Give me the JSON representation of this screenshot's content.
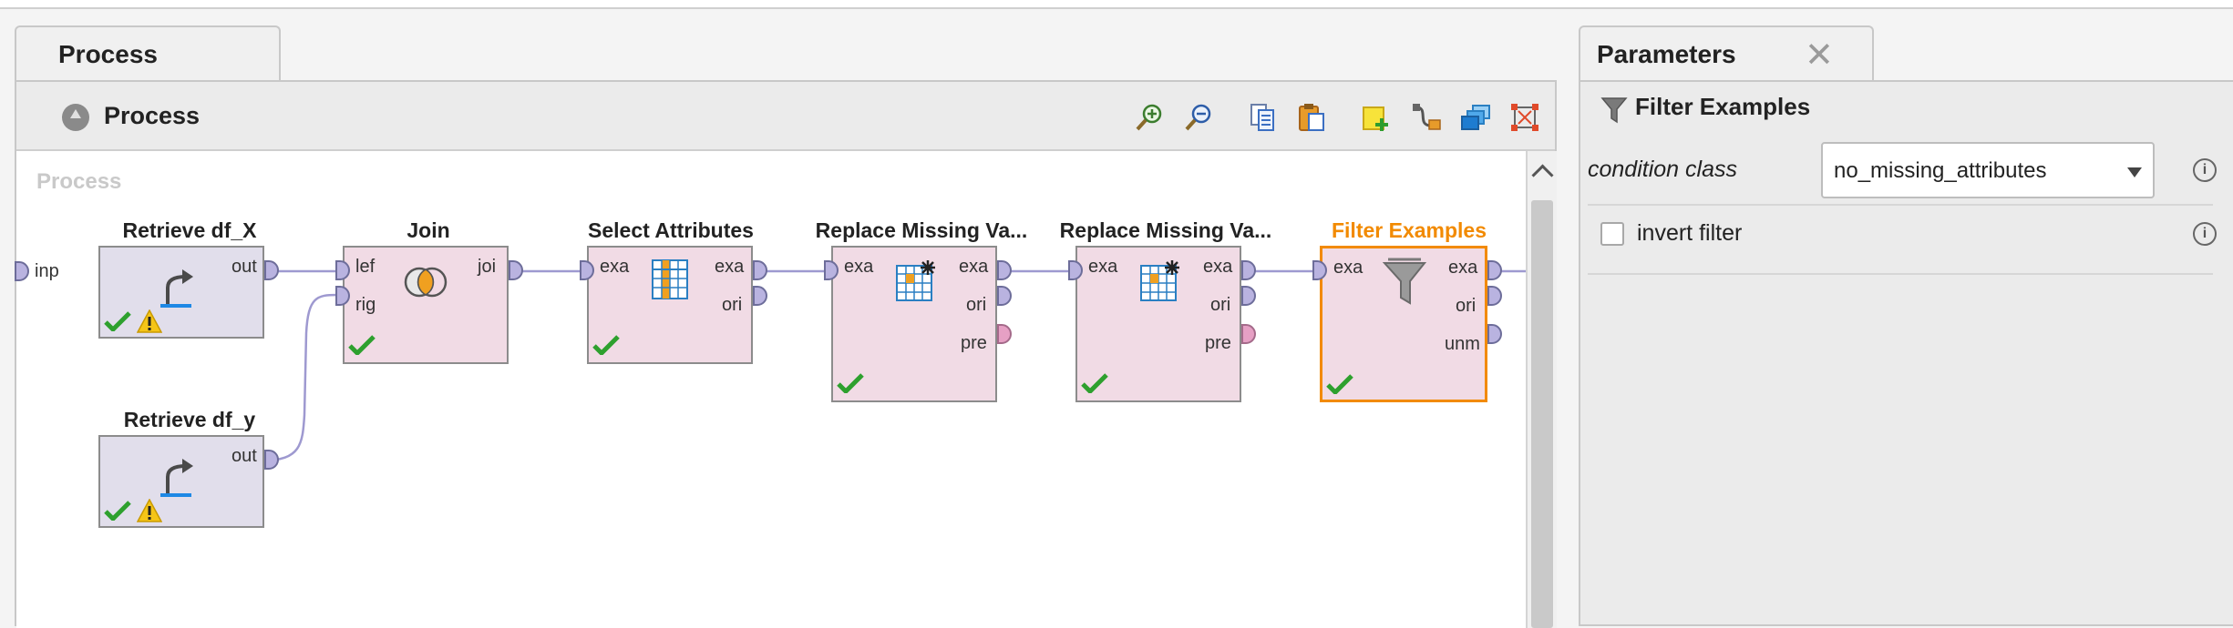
{
  "process_tab": {
    "label": "Process"
  },
  "breadcrumb": {
    "label": "Process"
  },
  "canvas": {
    "title": "Process",
    "input_port": "inp"
  },
  "toolbar": {
    "icons": [
      "zoom-in-icon",
      "zoom-out-icon",
      "copy-icon",
      "paste-icon",
      "add-note-icon",
      "auto-wire-icon",
      "arrange-icon",
      "fit-icon"
    ]
  },
  "operators": {
    "retrieve_x": {
      "title": "Retrieve df_X",
      "ports_out": [
        "out"
      ]
    },
    "retrieve_y": {
      "title": "Retrieve df_y",
      "ports_out": [
        "out"
      ]
    },
    "join": {
      "title": "Join",
      "ports_in": [
        "lef",
        "rig"
      ],
      "ports_out": [
        "joi"
      ]
    },
    "select_attributes": {
      "title": "Select Attributes",
      "ports_in": [
        "exa"
      ],
      "ports_out": [
        "exa",
        "ori"
      ]
    },
    "replace_missing_1": {
      "title": "Replace Missing Va...",
      "ports_in": [
        "exa"
      ],
      "ports_out": [
        "exa",
        "ori",
        "pre"
      ]
    },
    "replace_missing_2": {
      "title": "Replace Missing Va...",
      "ports_in": [
        "exa"
      ],
      "ports_out": [
        "exa",
        "ori",
        "pre"
      ]
    },
    "filter_examples": {
      "title": "Filter Examples",
      "ports_in": [
        "exa"
      ],
      "ports_out": [
        "exa",
        "ori",
        "unm"
      ]
    }
  },
  "parameters_tab": {
    "label": "Parameters",
    "close": "✕"
  },
  "parameters": {
    "operator_name": "Filter Examples",
    "condition_class": {
      "label": "condition class",
      "value": "no_missing_attributes"
    },
    "invert_filter": {
      "label": "invert filter",
      "checked": false
    }
  },
  "colors": {
    "selected": "#f28a00",
    "accent_blue": "#1e88e5"
  }
}
